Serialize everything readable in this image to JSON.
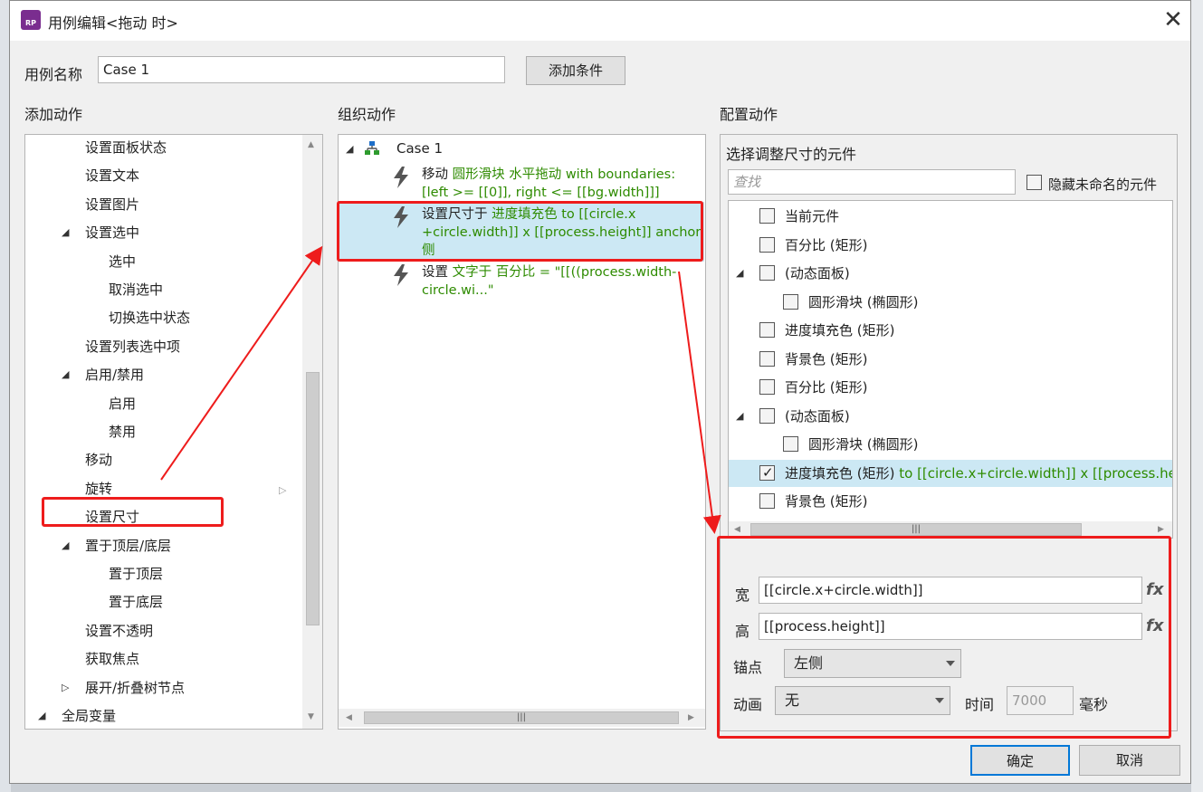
{
  "window": {
    "title": "用例编辑<拖动 时>",
    "app_badge": "RP"
  },
  "case_name": {
    "label": "用例名称",
    "value": "Case 1",
    "add_condition": "添加条件"
  },
  "left": {
    "heading": "添加动作",
    "items": [
      {
        "label": "设置面板状态",
        "indent": 1
      },
      {
        "label": "设置文本",
        "indent": 1
      },
      {
        "label": "设置图片",
        "indent": 1
      },
      {
        "label": "设置选中",
        "indent": 1,
        "expand": "open"
      },
      {
        "label": "选中",
        "indent": 2
      },
      {
        "label": "取消选中",
        "indent": 2
      },
      {
        "label": "切换选中状态",
        "indent": 2
      },
      {
        "label": "设置列表选中项",
        "indent": 1
      },
      {
        "label": "启用/禁用",
        "indent": 1,
        "expand": "open"
      },
      {
        "label": "启用",
        "indent": 2
      },
      {
        "label": "禁用",
        "indent": 2
      },
      {
        "label": "移动",
        "indent": 1
      },
      {
        "label": "旋转",
        "indent": 1
      },
      {
        "label": "设置尺寸",
        "indent": 1
      },
      {
        "label": "置于顶层/底层",
        "indent": 1,
        "expand": "open"
      },
      {
        "label": "置于顶层",
        "indent": 2
      },
      {
        "label": "置于底层",
        "indent": 2
      },
      {
        "label": "设置不透明",
        "indent": 1
      },
      {
        "label": "获取焦点",
        "indent": 1
      },
      {
        "label": "展开/折叠树节点",
        "indent": 1,
        "expand": "closed"
      },
      {
        "label": "全局变量",
        "indent": 0,
        "expand": "open"
      }
    ]
  },
  "middle": {
    "heading": "组织动作",
    "case_label": "Case 1",
    "actions": [
      {
        "verb": "移动 ",
        "detail": "圆形滑块 水平拖动 with boundaries:",
        "detail2": "[left >= [[0]], right <= [[bg.width]]]"
      },
      {
        "verb": "设置尺寸于 ",
        "detail": "进度填充色 to [[circle.x",
        "detail2": "+circle.width]] x [[process.height]] anchor 左",
        "detail3": "侧"
      },
      {
        "verb": "设置 ",
        "detail": "文字于 百分比 = \"[[((process.width-",
        "detail2": "circle.wi...\""
      }
    ]
  },
  "right": {
    "heading": "配置动作",
    "subheading": "选择调整尺寸的元件",
    "search_placeholder": "查找",
    "hide_unnamed": "隐藏未命名的元件",
    "widgets": [
      {
        "label": "当前元件",
        "level": 0,
        "checked": false
      },
      {
        "label": "百分比 (矩形)",
        "level": 0,
        "checked": false
      },
      {
        "label": "(动态面板)",
        "level": 0,
        "checked": false,
        "expand": "open"
      },
      {
        "label": "圆形滑块 (椭圆形)",
        "level": 1,
        "checked": false
      },
      {
        "label": "进度填充色 (矩形)",
        "level": 0,
        "checked": false
      },
      {
        "label": "背景色 (矩形)",
        "level": 0,
        "checked": false
      },
      {
        "label": "百分比 (矩形)",
        "level": 0,
        "checked": false
      },
      {
        "label": "(动态面板)",
        "level": 0,
        "checked": false,
        "expand": "open"
      },
      {
        "label": "圆形滑块 (椭圆形)",
        "level": 1,
        "checked": false
      },
      {
        "label": "进度填充色 (矩形)",
        "level": 0,
        "checked": true,
        "extra": " to [[circle.x+circle.width]] x [[process.height]]"
      },
      {
        "label": "背景色 (矩形)",
        "level": 0,
        "checked": false
      }
    ],
    "width_label": "宽",
    "width_value": "[[circle.x+circle.width]]",
    "height_label": "高",
    "height_value": "[[process.height]]",
    "fx": "fx",
    "anchor_label": "锚点",
    "anchor_value": "左侧",
    "animation_label": "动画",
    "animation_value": "无",
    "time_label": "时间",
    "time_value": "7000",
    "ms_label": "毫秒"
  },
  "buttons": {
    "ok": "确定",
    "cancel": "取消"
  },
  "colors": {
    "highlight_red": "#ee1c1c",
    "action_green": "#2e8b00",
    "selected_row": "#cce8f4"
  }
}
